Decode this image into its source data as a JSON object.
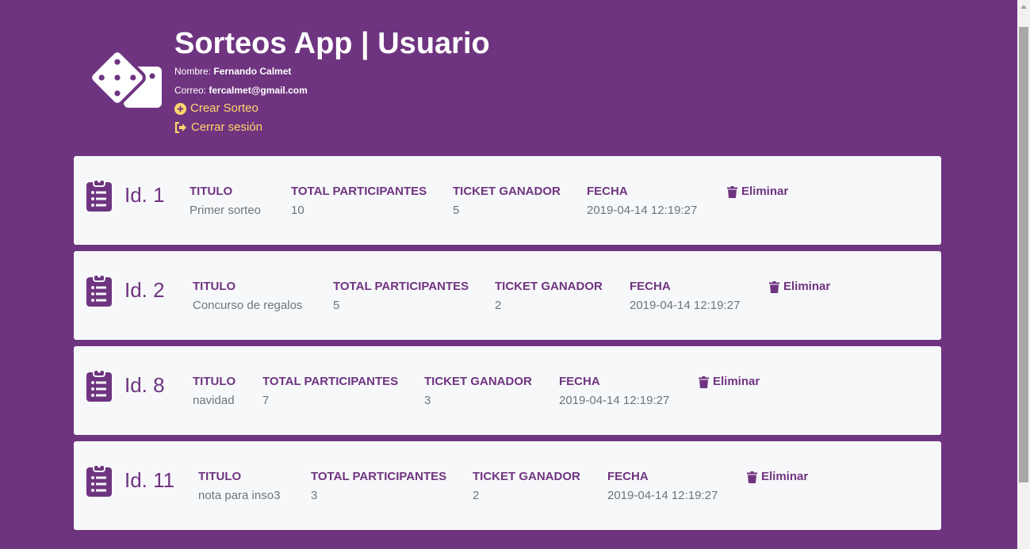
{
  "header": {
    "title": "Sorteos App | Usuario",
    "name_label": "Nombre:",
    "name_value": "Fernando Calmet",
    "email_label": "Correo:",
    "email_value": "fercalmet@gmail.com",
    "create_link": "Crear Sorteo",
    "logout_link": "Cerrar sesión",
    "link_color": "#ffd66b",
    "background_color": "#6f3480"
  },
  "columns": {
    "title": "TITULO",
    "participants": "TOTAL PARTICIPANTES",
    "winner": "TICKET GANADOR",
    "date": "FECHA",
    "delete": "Eliminar"
  },
  "draws": [
    {
      "id_label": "Id. 1",
      "titulo": "Primer sorteo",
      "participantes": "10",
      "ganador": "5",
      "fecha": "2019-04-14 12:19:27"
    },
    {
      "id_label": "Id. 2",
      "titulo": "Concurso de regalos",
      "participantes": "5",
      "ganador": "2",
      "fecha": "2019-04-14 12:19:27"
    },
    {
      "id_label": "Id. 8",
      "titulo": "navidad",
      "participantes": "7",
      "ganador": "3",
      "fecha": "2019-04-14 12:19:27"
    },
    {
      "id_label": "Id. 11",
      "titulo": "nota para inso3",
      "participantes": "3",
      "ganador": "2",
      "fecha": "2019-04-14 12:19:27"
    }
  ],
  "icons": {
    "logo": "dice-icon",
    "card": "clipboard-list-icon",
    "create": "plus-circle-icon",
    "logout": "sign-out-icon",
    "delete": "trash-icon"
  }
}
